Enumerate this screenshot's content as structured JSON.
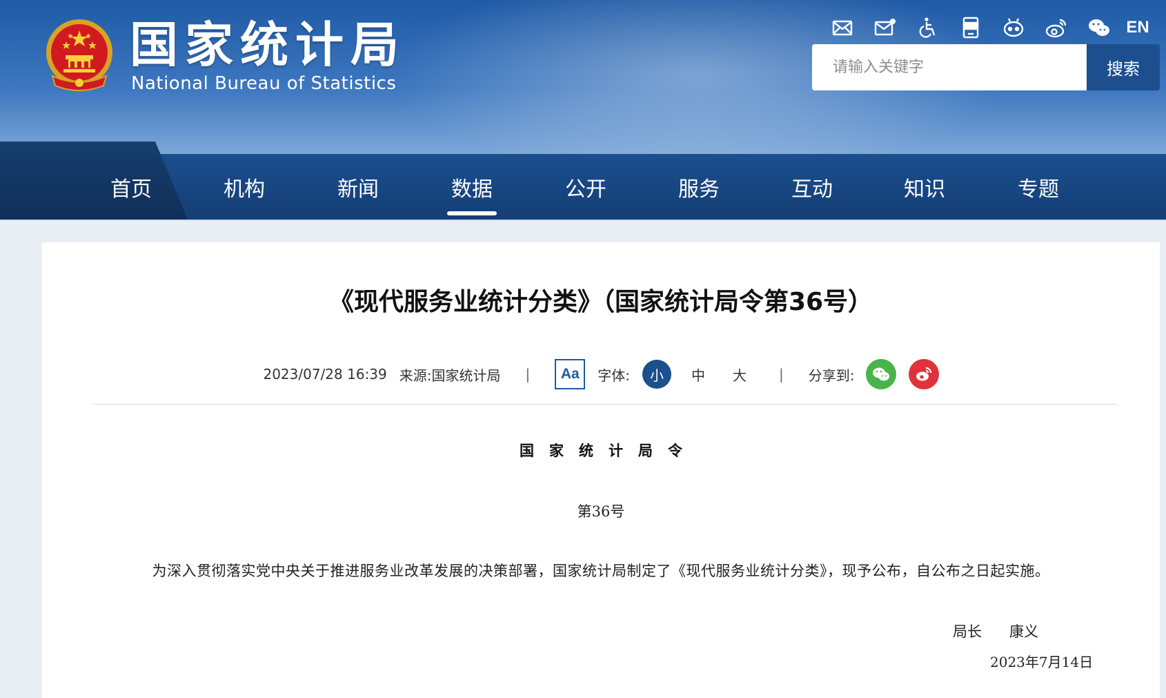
{
  "header": {
    "site_title": "国家统计局",
    "site_subtitle": "National Bureau of Statistics",
    "icons": [
      "mail-icon",
      "mail-subscribe-icon",
      "accessibility-icon",
      "app-icon",
      "robot-icon",
      "weibo-icon",
      "wechat-icon"
    ],
    "language_label": "EN",
    "search": {
      "placeholder": "请输入关键字",
      "button_label": "搜索"
    }
  },
  "nav": {
    "items": [
      {
        "label": "首页"
      },
      {
        "label": "机构"
      },
      {
        "label": "新闻"
      },
      {
        "label": "数据",
        "active": true
      },
      {
        "label": "公开"
      },
      {
        "label": "服务"
      },
      {
        "label": "互动"
      },
      {
        "label": "知识"
      },
      {
        "label": "专题"
      }
    ]
  },
  "article": {
    "title": "《现代服务业统计分类》（国家统计局令第36号）",
    "meta": {
      "datetime": "2023/07/28 16:39",
      "source_label": "来源:",
      "source_value": "国家统计局",
      "separator": "|",
      "font_toggle_label": "Aa",
      "font_size_label": "字体:",
      "font_sizes": [
        "小",
        "中",
        "大"
      ],
      "font_size_active": "小",
      "share_label": "分享到:"
    },
    "order_heading": "国家统计局令",
    "order_number": "第36号",
    "body": "为深入贯彻落实党中央关于推进服务业改革发展的决策部署，国家统计局制定了《现代服务业统计分类》，现予公布，自公布之日起实施。",
    "signatory_title": "局长",
    "signatory_name": "康义",
    "sign_date": "2023年7月14日"
  },
  "colors": {
    "nav_bg": "#1b4f8e",
    "accent": "#1d5aa0",
    "wechat": "#4ab34a",
    "weibo": "#e0323a"
  }
}
